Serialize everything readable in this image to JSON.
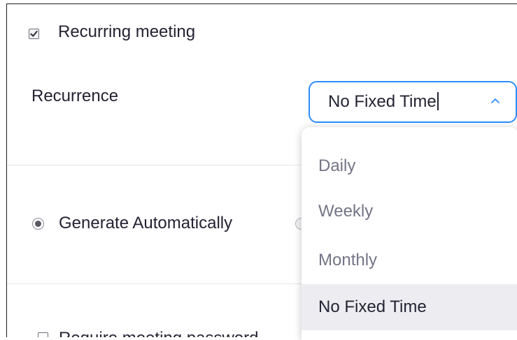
{
  "recurring_meeting": {
    "label": "Recurring meeting",
    "checked": true
  },
  "recurrence": {
    "label": "Recurrence",
    "value": "No Fixed Time",
    "expanded": true,
    "options": [
      "Daily",
      "Weekly",
      "Monthly",
      "No Fixed Time"
    ],
    "selected_option": "No Fixed Time"
  },
  "meeting_id": {
    "generate_automatically_label": "Generate Automatically",
    "generate_automatically_selected": true
  },
  "meeting_password": {
    "label": "Require meeting password",
    "checked": false
  },
  "colors": {
    "accent": "#2d8cff",
    "text": "#232333",
    "muted_text": "#747487",
    "selected_option_bg": "#ededf1"
  }
}
